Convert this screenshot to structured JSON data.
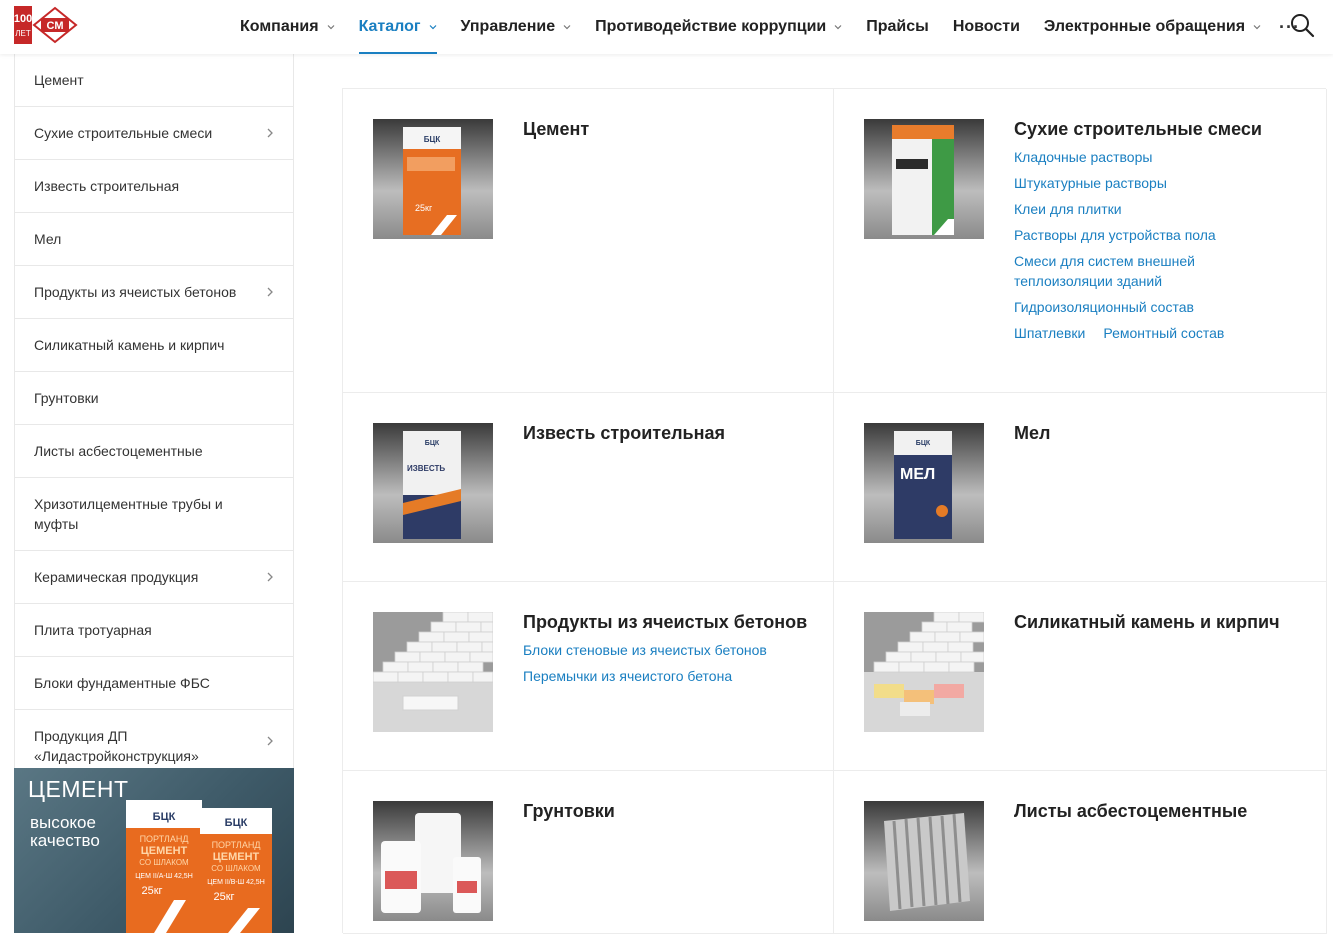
{
  "header": {
    "logo_label": "100 лет СМ",
    "nav": [
      {
        "label": "Компания",
        "dropdown": true,
        "active": false
      },
      {
        "label": "Каталог",
        "dropdown": true,
        "active": true
      },
      {
        "label": "Управление",
        "dropdown": true,
        "active": false
      },
      {
        "label": "Противодействие коррупции",
        "dropdown": true,
        "active": false
      },
      {
        "label": "Прайсы",
        "dropdown": false,
        "active": false
      },
      {
        "label": "Новости",
        "dropdown": false,
        "active": false
      },
      {
        "label": "Электронные обращения",
        "dropdown": true,
        "active": false
      }
    ],
    "more": "···",
    "search_icon": "search-icon",
    "accent_color": "#1a7fc1"
  },
  "sidebar": {
    "items": [
      {
        "label": "Цемент",
        "has_submenu": false
      },
      {
        "label": "Сухие строительные смеси",
        "has_submenu": true
      },
      {
        "label": "Известь строительная",
        "has_submenu": false
      },
      {
        "label": "Мел",
        "has_submenu": false
      },
      {
        "label": "Продукты из ячеистых бетонов",
        "has_submenu": true
      },
      {
        "label": "Силикатный камень и кирпич",
        "has_submenu": false
      },
      {
        "label": "Грунтовки",
        "has_submenu": false
      },
      {
        "label": "Листы асбестоцементные",
        "has_submenu": false
      },
      {
        "label": "Хризотилцементные трубы и муфты",
        "has_submenu": false
      },
      {
        "label": "Керамическая продукция",
        "has_submenu": true
      },
      {
        "label": "Плита тротуарная",
        "has_submenu": false
      },
      {
        "label": "Блоки фундаментные ФБС",
        "has_submenu": false
      },
      {
        "label": "Продукция ДП «Лидастройконструкция»",
        "has_submenu": true
      }
    ]
  },
  "banner": {
    "title": "ЦЕМЕНТ",
    "subtitle": "высокое качество",
    "bag_brand": "БЦК",
    "bag1": {
      "line1": "ПОРТЛАНД",
      "line2": "ЦЕМЕНТ",
      "line3": "СО ШЛАКОМ",
      "grade": "ЦЕМ II/А-Ш 42,5Н",
      "weight": "25кг"
    },
    "bag2": {
      "line1": "ПОРТЛАНД",
      "line2": "ЦЕМЕНТ",
      "line3": "СО ШЛАКОМ",
      "grade": "ЦЕМ II/В-Ш 42,5Н",
      "weight": "25кг"
    }
  },
  "catalog": [
    {
      "title": "Цемент",
      "image": "cement-bag",
      "links": []
    },
    {
      "title": "Сухие строительные смеси",
      "image": "dry-mix-bag",
      "links": [
        "Кладочные растворы",
        "Штукатурные растворы",
        "Клеи для плитки",
        "Растворы для устройства пола",
        "Смеси для систем внешней теплоизоляции зданий",
        "Гидроизоляционный состав"
      ],
      "inline_links": [
        "Шпатлевки",
        "Ремонтный состав"
      ]
    },
    {
      "title": "Известь строительная",
      "image": "lime-bag",
      "links": []
    },
    {
      "title": "Мел",
      "image": "chalk-bag",
      "links": []
    },
    {
      "title": "Продукты из ячеистых бетонов",
      "image": "aerated-blocks",
      "links": [
        "Блоки стеновые из ячеистых бетонов",
        "Перемычки из ячеистого бетона"
      ]
    },
    {
      "title": "Силикатный камень и кирпич",
      "image": "silicate-bricks",
      "links": []
    },
    {
      "title": "Грунтовки",
      "image": "primer-cans",
      "links": []
    },
    {
      "title": "Листы асбестоцементные",
      "image": "corrugated-sheets",
      "links": []
    }
  ],
  "bag_labels": {
    "cement_weight": "25кг",
    "lime": "ИЗВЕСТЬ",
    "chalk": "МЕЛ",
    "brand": "БЦК"
  }
}
